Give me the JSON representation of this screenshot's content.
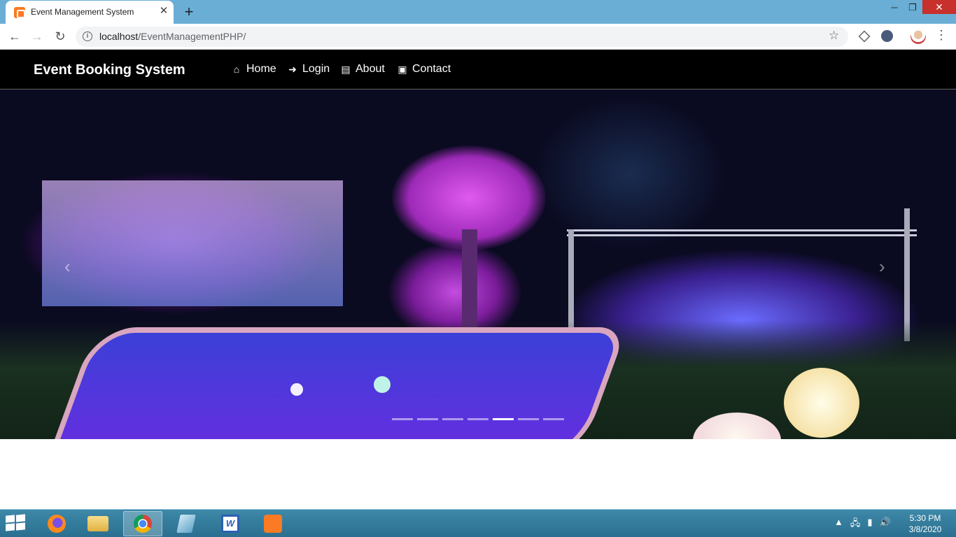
{
  "browser": {
    "tab_title": "Event Management System",
    "tab_close": "✕",
    "new_tab": "+",
    "url_host": "localhost",
    "url_path": "/EventManagementPHP/",
    "window_controls": {
      "minimize": "─",
      "restore": "❐",
      "close": "✕"
    },
    "back": "←",
    "forward": "→",
    "reload": "↻",
    "star": "☆",
    "menu": "⋮"
  },
  "site": {
    "brand": "Event Booking System",
    "nav": [
      {
        "label": "Home",
        "icon": "home-icon",
        "glyph": "⌂"
      },
      {
        "label": "Login",
        "icon": "sign-in-icon",
        "glyph": "➜"
      },
      {
        "label": "About",
        "icon": "id-card-icon",
        "glyph": "▤"
      },
      {
        "label": "Contact",
        "icon": "address-book-icon",
        "glyph": "▣"
      }
    ]
  },
  "carousel": {
    "prev": "‹",
    "next": "›",
    "slide_count": 7,
    "active_slide": 5
  },
  "taskbar": {
    "apps": [
      "firefox",
      "file-explorer",
      "chrome",
      "notepad",
      "word",
      "xampp"
    ],
    "active_app": "chrome",
    "time": "5:30 PM",
    "date": "3/8/2020",
    "tray_icons": [
      "show-hidden-icons",
      "network-icon",
      "power-icon",
      "volume-icon"
    ]
  },
  "colors": {
    "nav_bg": "#000000",
    "titlebar": "#6aaed6",
    "taskbar": "#2f7a9c",
    "close": "#c7302b"
  }
}
